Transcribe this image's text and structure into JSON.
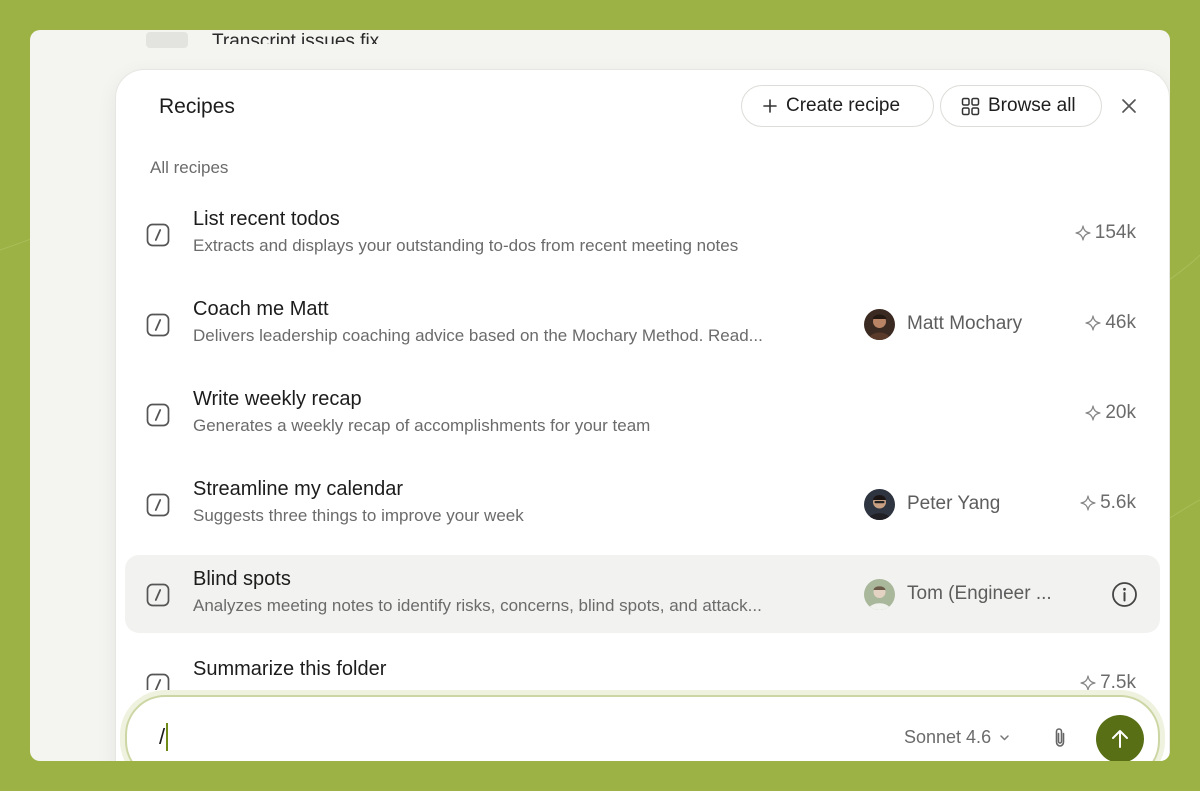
{
  "behind": {
    "title": "Transcript issues fix"
  },
  "panel": {
    "title": "Recipes",
    "create_label": "Create recipe",
    "browse_label": "Browse all",
    "section_label": "All recipes"
  },
  "recipes": [
    {
      "title": "List recent todos",
      "description": "Extracts and displays your outstanding to-dos from recent meeting notes",
      "author": "",
      "count": "154k"
    },
    {
      "title": "Coach me Matt",
      "description": "Delivers leadership coaching advice based on the Mochary Method. Read...",
      "author": "Matt Mochary",
      "count": "46k"
    },
    {
      "title": "Write weekly recap",
      "description": "Generates a weekly recap of accomplishments for your team",
      "author": "",
      "count": "20k"
    },
    {
      "title": "Streamline my calendar",
      "description": "Suggests three things to improve your week",
      "author": "Peter Yang",
      "count": "5.6k"
    },
    {
      "title": "Blind spots",
      "description": "Analyzes meeting notes to identify risks, concerns, blind spots, and attack...",
      "author": "Tom (Engineer ...",
      "count": ""
    },
    {
      "title": "Summarize this folder",
      "description": "",
      "author": "",
      "count": "7.5k"
    }
  ],
  "composer": {
    "value": "/",
    "model": "Sonnet 4.6"
  },
  "icons": {
    "create": "plus-icon",
    "browse": "grid-icon",
    "close": "close-icon",
    "recipe": "slash-command-icon",
    "count": "sparkle-icon",
    "info": "info-icon",
    "model": "chevron-down-icon",
    "attach": "paperclip-icon",
    "send": "arrow-up-icon"
  },
  "colors": {
    "background": "#9db244",
    "accent": "#586f15",
    "highlight_row": "#f2f2f0",
    "composer_border": "#ccd6a4"
  }
}
